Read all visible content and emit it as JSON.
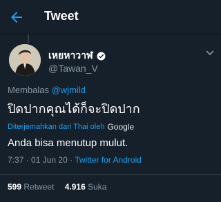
{
  "header": {
    "title": "Tweet",
    "back_icon": "arrow-left-icon"
  },
  "user": {
    "name": "เหยหาวาฬ",
    "handle": "@Tawan_V",
    "verified": true
  },
  "reply": {
    "prefix": "Membalas",
    "mention": "@wjmild"
  },
  "tweet": {
    "text": "ปิดปากคุณได้ก็จะปิดปาก",
    "translated_note": "Diterjemahkan dari Thai oleh",
    "translator": "Google",
    "translation": "Anda bisa menutup mulut."
  },
  "meta": {
    "time": "7:37",
    "separator": " · ",
    "date": "01 Jun 20",
    "source": "Twitter for Android"
  },
  "stats": {
    "retweets_count": "599",
    "retweets_label": "Retweet",
    "likes_count": "4.916",
    "likes_label": "Suka"
  },
  "colors": {
    "background": "#15202b",
    "accent": "#1da1f2",
    "muted": "#8899a6"
  }
}
